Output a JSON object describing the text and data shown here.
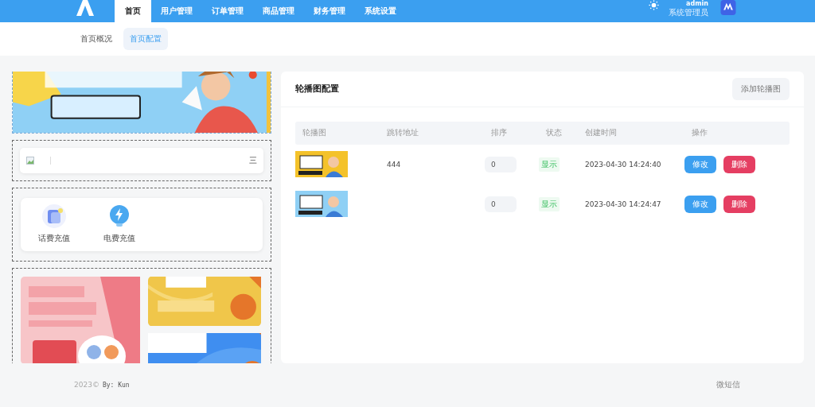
{
  "header": {
    "nav": [
      {
        "label": "首页",
        "selected": true
      },
      {
        "label": "用户管理",
        "selected": false
      },
      {
        "label": "订单管理",
        "selected": false
      },
      {
        "label": "商品管理",
        "selected": false
      },
      {
        "label": "财务管理",
        "selected": false
      },
      {
        "label": "系统设置",
        "selected": false
      }
    ],
    "user": {
      "name": "admin",
      "role": "系统管理员"
    }
  },
  "subtabs": [
    {
      "label": "首页概况",
      "selected": false
    },
    {
      "label": "首页配置",
      "selected": true
    }
  ],
  "preview": {
    "notice": {
      "text": "三"
    },
    "shortcuts": [
      {
        "label": "话费充值",
        "kind": "phone"
      },
      {
        "label": "电费充值",
        "kind": "power"
      }
    ]
  },
  "carousel_config": {
    "title": "轮播图配置",
    "add_button": "添加轮播图",
    "columns": [
      "轮播图",
      "跳转地址",
      "排序",
      "状态",
      "创建时间",
      "操作"
    ],
    "rows": [
      {
        "jump_url": "444",
        "sort": "0",
        "status": "显示",
        "created": "2023-04-30 14:24:40",
        "actions": [
          {
            "label": "修改",
            "kind": "edit"
          },
          {
            "label": "删除",
            "kind": "delete"
          }
        ]
      },
      {
        "sort": "0",
        "status": "显示",
        "created": "2023-04-30 14:24:47",
        "actions": [
          {
            "label": "修改",
            "kind": "edit"
          },
          {
            "label": "删除",
            "kind": "delete"
          }
        ]
      }
    ]
  },
  "footer": {
    "copyright": "2023©",
    "author": "By: Kun",
    "brand": "微短信"
  }
}
